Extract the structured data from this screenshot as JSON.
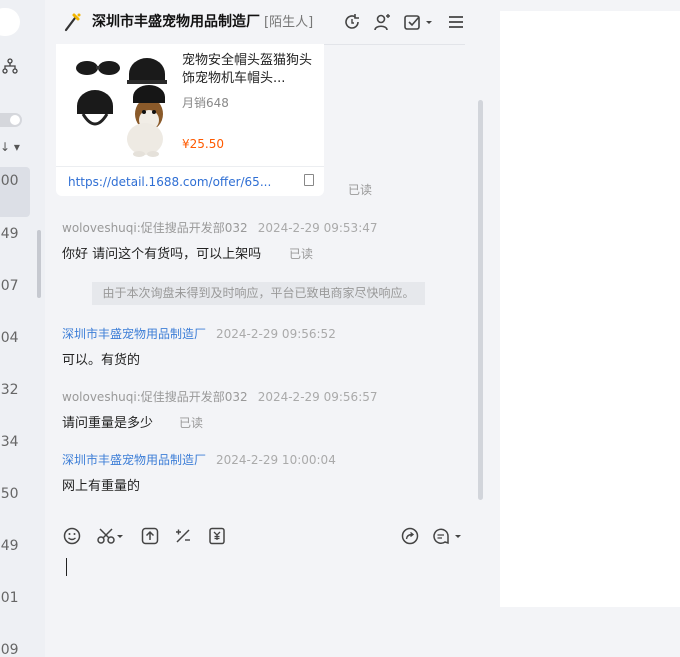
{
  "sidebar_strip": {
    "times": [
      ":00",
      ":49",
      ":07",
      ":04",
      ":32",
      ":34",
      ":50",
      ":49",
      ":01",
      ":09"
    ]
  },
  "header": {
    "title": "深圳市丰盛宠物用品制造厂",
    "tag": "[陌生人]",
    "icons": [
      "refresh-icon",
      "user-icon",
      "task-check-icon",
      "menu-icon"
    ]
  },
  "product": {
    "name": "宠物安全帽头盔猫狗头饰宠物机车帽头...",
    "sales": "月销648",
    "price": "¥25.50",
    "link": "https://detail.1688.com/offer/65...",
    "read": "已读"
  },
  "messages": [
    {
      "sender": "woloveshuqi:促佳搜品开发部032",
      "time": "2024-2-29 09:53:47",
      "text": "你好 请问这个有货吗，可以上架吗",
      "read": "已读"
    },
    {
      "notice": "由于本次询盘未得到及时响应，平台已致电商家尽快响应。"
    },
    {
      "sender": "深圳市丰盛宠物用品制造厂",
      "time": "2024-2-29 09:56:52",
      "text": "可以。有货的"
    },
    {
      "sender": "woloveshuqi:促佳搜品开发部032",
      "time": "2024-2-29 09:56:57",
      "text": "请问重量是多少",
      "read": "已读"
    },
    {
      "sender": "深圳市丰盛宠物用品制造厂",
      "time": "2024-2-29 10:00:04",
      "text": "网上有重量的"
    }
  ],
  "input_toolbar": {
    "icons": [
      "emoji-icon",
      "scissors-icon",
      "upload-icon",
      "discount-icon",
      "coupon-icon",
      "share-icon",
      "quick-reply-icon"
    ]
  },
  "colors": {
    "shop_name": "#3d7ed7",
    "price": "#ff5a00",
    "link": "#2f6fd4"
  }
}
